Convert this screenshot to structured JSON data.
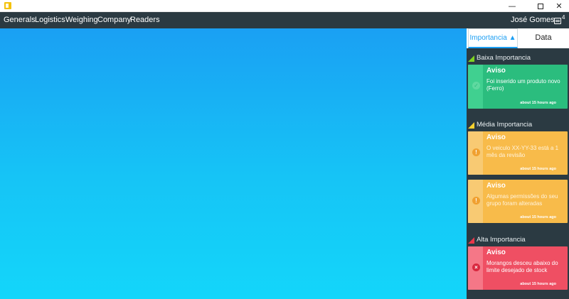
{
  "window": {
    "minimize_glyph": "—",
    "close_glyph": "✕"
  },
  "nav": {
    "items": [
      "Generals",
      "Logistics",
      "Weighing",
      "Company",
      "Readers"
    ],
    "user_name": "José Gomes",
    "notification_count": "4"
  },
  "panel": {
    "tabs": {
      "importance_label": "Importancia",
      "importance_sort_glyph": "▲",
      "date_label": "Data"
    },
    "sections": [
      {
        "title": "Baixa Importancia",
        "color": "#7ed321",
        "cards": [
          {
            "title": "Aviso",
            "message": "Foi inserido um produto novo (Ferro)",
            "time": "about 15 hours ago",
            "icon": "check-circle-icon"
          }
        ]
      },
      {
        "title": "Média Importancia",
        "color": "#f8d12f",
        "cards": [
          {
            "title": "Aviso",
            "message": "O veiculo XX-YY-33 está a 1 mês da revisão",
            "time": "about 15 hours ago",
            "icon": "exclamation-circle-icon"
          },
          {
            "title": "Aviso",
            "message": "Algumas permissões do seu grupo foram alteradas",
            "time": "about 15 hours ago",
            "icon": "exclamation-circle-icon"
          }
        ]
      },
      {
        "title": "Alta Importancia",
        "color": "#e8374a",
        "cards": [
          {
            "title": "Aviso",
            "message": "Morangos desceu abaixo do limite desejado de stock",
            "time": "about 15 hours ago",
            "icon": "x-circle-icon"
          }
        ]
      }
    ]
  },
  "colors": {
    "navbar": "#2b3a42",
    "main_gradient_top": "#1aa0f3",
    "main_gradient_bottom": "#13d6fa",
    "accent": "#1a9ef3"
  }
}
